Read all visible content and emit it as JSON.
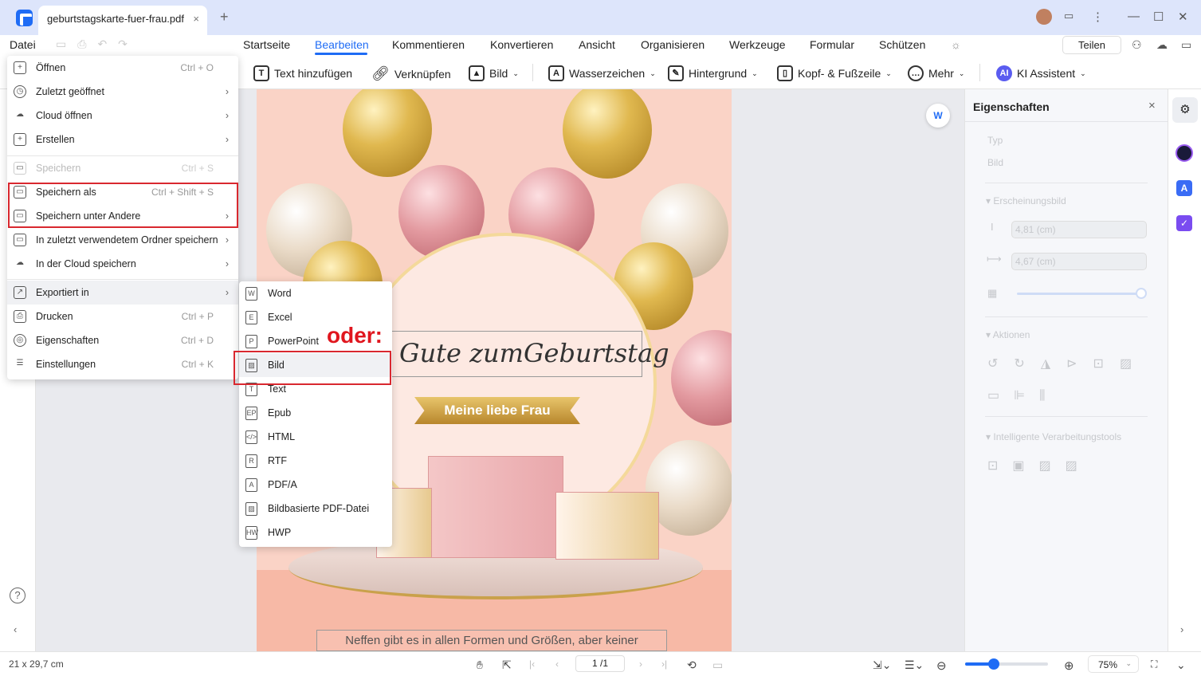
{
  "titlebar": {
    "tab_title": "geburtstagskarte-fuer-frau.pdf",
    "close": "×",
    "new_tab": "+",
    "window_controls": [
      "—",
      "☐",
      "✕"
    ]
  },
  "menubar": {
    "file": "Datei",
    "tabs": [
      "Startseite",
      "Bearbeiten",
      "Kommentieren",
      "Konvertieren",
      "Ansicht",
      "Organisieren",
      "Werkzeuge",
      "Formular",
      "Schützen"
    ],
    "active_tab": "Bearbeiten",
    "share": "Teilen"
  },
  "toolbar": {
    "items": [
      {
        "label": "Text hinzufügen",
        "icon": "text-box-icon"
      },
      {
        "label": "Verknüpfen",
        "icon": "link-icon"
      },
      {
        "label": "Bild",
        "icon": "image-icon"
      },
      {
        "label": "Wasserzeichen",
        "icon": "watermark-icon"
      },
      {
        "label": "Hintergrund",
        "icon": "background-icon"
      },
      {
        "label": "Kopf- & Fußzeile",
        "icon": "header-footer-icon"
      },
      {
        "label": "Mehr",
        "icon": "more-icon"
      },
      {
        "label": "KI Assistent",
        "icon": "ai-icon"
      }
    ]
  },
  "file_menu": {
    "items": [
      {
        "label": "Öffnen",
        "shortcut": "Ctrl + O",
        "icon": "+"
      },
      {
        "label": "Zuletzt geöffnet",
        "arrow": true,
        "icon": "◷"
      },
      {
        "label": "Cloud öffnen",
        "arrow": true,
        "icon": "☁"
      },
      {
        "label": "Erstellen",
        "arrow": true,
        "icon": "+"
      },
      {
        "label": "Speichern",
        "shortcut": "Ctrl + S",
        "disabled": true,
        "icon": "▭"
      },
      {
        "label": "Speichern als",
        "shortcut": "Ctrl + Shift + S",
        "icon": "▭"
      },
      {
        "label": "Speichern unter Andere",
        "arrow": true,
        "icon": "▭"
      },
      {
        "label": "In zuletzt verwendetem Ordner speichern",
        "arrow": true,
        "icon": "▭"
      },
      {
        "label": "In der Cloud speichern",
        "arrow": true,
        "icon": "☁"
      },
      {
        "label": "Exportiert in",
        "arrow": true,
        "highlight": true,
        "icon": "↗"
      },
      {
        "label": "Drucken",
        "shortcut": "Ctrl + P",
        "icon": "⎙"
      },
      {
        "label": "Eigenschaften",
        "shortcut": "Ctrl + D",
        "icon": "◎"
      },
      {
        "label": "Einstellungen",
        "shortcut": "Ctrl + K",
        "icon": "☰"
      }
    ]
  },
  "export_menu": {
    "items": [
      {
        "label": "Word",
        "icon": "W"
      },
      {
        "label": "Excel",
        "icon": "E"
      },
      {
        "label": "PowerPoint",
        "icon": "P"
      },
      {
        "label": "Bild",
        "icon": "▨",
        "highlight": true
      },
      {
        "label": "Text",
        "icon": "T"
      },
      {
        "label": "Epub",
        "icon": "EP"
      },
      {
        "label": "HTML",
        "icon": "</>"
      },
      {
        "label": "RTF",
        "icon": "R"
      },
      {
        "label": "PDF/A",
        "icon": "A"
      },
      {
        "label": "Bildbasierte PDF-Datei",
        "icon": "▨"
      },
      {
        "label": "HWP",
        "icon": "HW"
      }
    ]
  },
  "annotation": {
    "text": "oder:",
    "color": "#e0161e"
  },
  "document": {
    "greeting": "lles Gute zumGeburtstag",
    "banner": "Meine liebe Frau",
    "footer": "Neffen gibt es in allen Formen und Größen, aber keiner"
  },
  "properties": {
    "title": "Eigenschaften",
    "type_label": "Typ",
    "type_value": "Bild",
    "appearance": "Erscheinungsbild",
    "height": "4,81 (cm)",
    "width": "4,67 (cm)",
    "opacity": 1.0,
    "actions": "Aktionen",
    "smart_tools": "Intelligente Verarbeitungstools"
  },
  "statusbar": {
    "page_size": "21 x 29,7 cm",
    "page": "1 /1",
    "zoom": "75%",
    "zoom_slider": 0.35
  },
  "colors": {
    "accent": "#1f6cf5",
    "highlight_box": "#d9282f"
  }
}
